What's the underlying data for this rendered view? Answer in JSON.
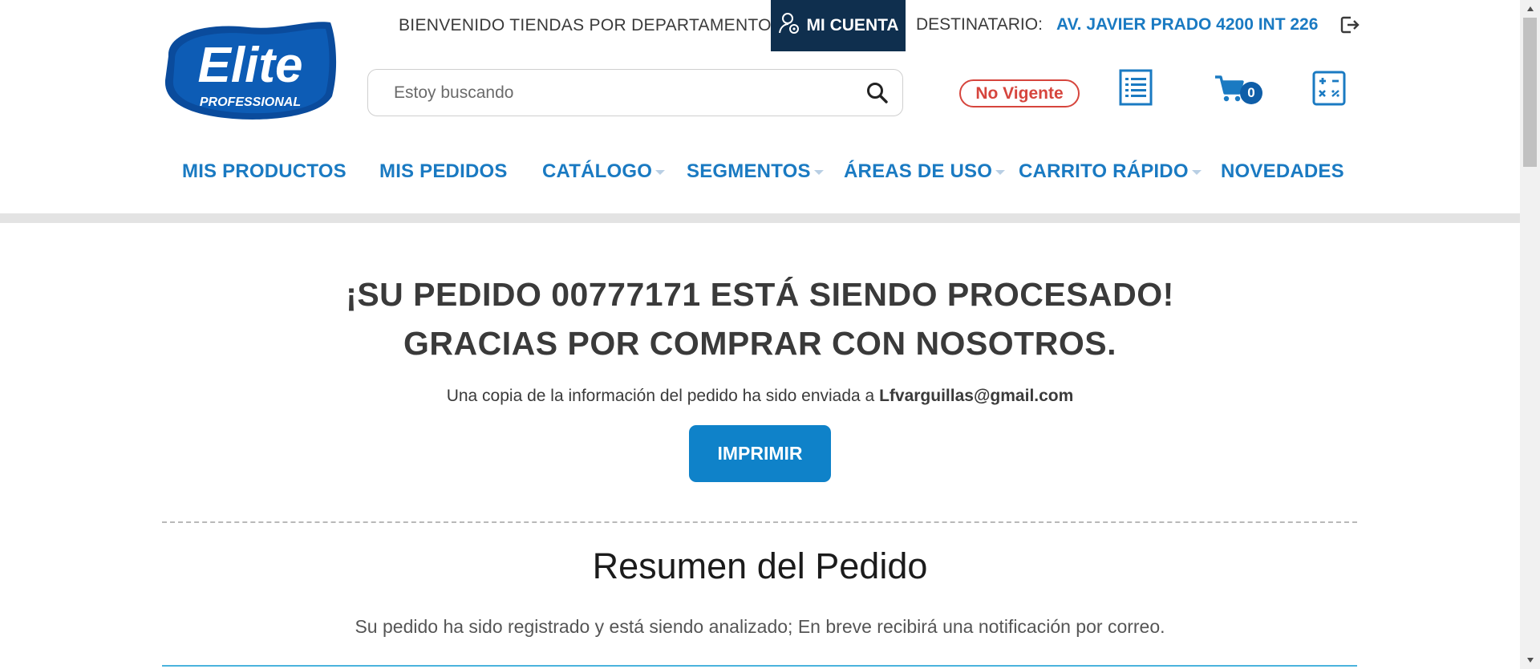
{
  "header": {
    "logo_brand": "Elite",
    "logo_sub": "PROFESSIONAL",
    "welcome": "BIENVENIDO TIENDAS POR DEPARTAMENTO",
    "account_label": "MI CUENTA",
    "destination_label": "DESTINATARIO:",
    "destination_value": "AV. JAVIER PRADO 4200 INT 226",
    "search_placeholder": "Estoy buscando",
    "status_badge": "No Vigente",
    "cart_count": "0",
    "icons": {
      "account": "user-settings-icon",
      "logout": "logout-icon",
      "search": "search-icon",
      "list": "list-icon",
      "cart": "cart-icon",
      "calculator": "calculator-icon"
    }
  },
  "nav": {
    "items": [
      {
        "label": "MIS PRODUCTOS"
      },
      {
        "label": "MIS PEDIDOS"
      },
      {
        "label": "CATÁLOGO"
      },
      {
        "label": "SEGMENTOS"
      },
      {
        "label": "ÁREAS DE USO"
      },
      {
        "label": "CARRITO RÁPIDO"
      },
      {
        "label": "NOVEDADES"
      }
    ]
  },
  "main": {
    "title_line1": "¡SU PEDIDO 00777171 ESTÁ SIENDO PROCESADO!",
    "title_line2": "GRACIAS POR COMPRAR CON NOSOTROS.",
    "copy_text": "Una copia de la información del pedido ha sido enviada a ",
    "email": "Lfvarguillas@gmail.com",
    "print_label": "IMPRIMIR",
    "summary_title": "Resumen del Pedido",
    "summary_note": "Su pedido ha sido registrado y está siendo analizado; En breve recibirá una notificación por correo."
  },
  "colors": {
    "brand_blue": "#1a7ac2",
    "dark_navy": "#0f2f4e",
    "button_blue": "#0f82c9",
    "alert_red": "#d6453d"
  }
}
